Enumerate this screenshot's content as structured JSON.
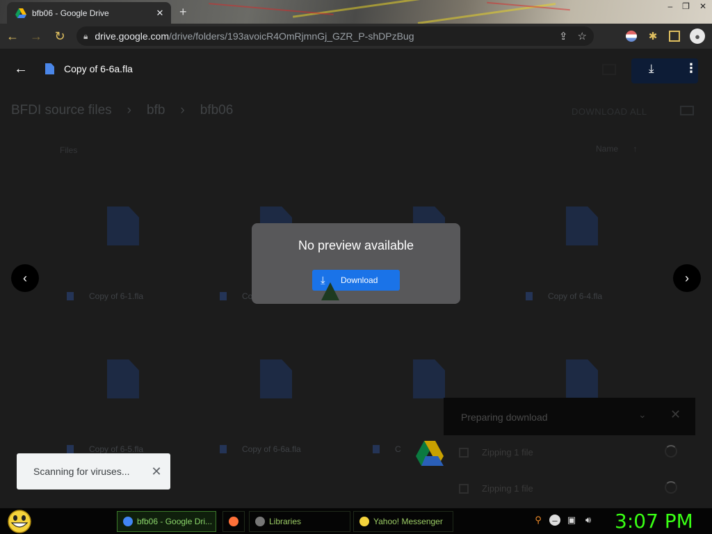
{
  "browser": {
    "tab_title": "bfb06 - Google Drive",
    "tab_close": "✕",
    "new_tab": "+",
    "url_host": "drive.google.com",
    "url_path": "/drive/folders/193avoicR4OmRjmnGj_GZR_P-shDPzBug",
    "window_controls": [
      "–",
      "❐",
      "✕"
    ],
    "nav": {
      "back": "←",
      "forward": "→",
      "reload": "↻"
    },
    "omnibox_icons": [
      "share-icon",
      "star-icon"
    ],
    "extension_icons": [
      "flag-icon",
      "puzzle-icon",
      "sidebar-icon",
      "profile-icon"
    ]
  },
  "viewer": {
    "back_label": "←",
    "file_title": "Copy of 6-6a.fla",
    "download_icon": "⤓",
    "menu_icon": "⋮",
    "prev": "‹",
    "next": "›",
    "no_preview": "No preview available",
    "download_button": "Download"
  },
  "drive": {
    "breadcrumb": [
      "BFDI source files",
      "›",
      "bfb",
      "›",
      "bfb06"
    ],
    "download_all": "DOWNLOAD ALL",
    "files_header": "Files",
    "name_header": "Name",
    "sort_arrow": "↑",
    "files_row1": [
      "Copy of 6-1.fla",
      "Co",
      "",
      "Copy of 6-4.fla"
    ],
    "files_row2": [
      "Copy of 6-5.fla",
      "Copy of 6-6a.fla",
      "C",
      ""
    ]
  },
  "downloads": {
    "title": "Preparing download",
    "chevron": "⌄",
    "close": "✕",
    "rows": [
      "Zipping 1 file",
      "Zipping 1 file"
    ]
  },
  "toast": {
    "text": "Scanning for viruses...",
    "close": "✕"
  },
  "taskbar": {
    "tasks": [
      {
        "label": "bfb06 - Google Dri...",
        "icon_color": "#4285f4",
        "active": true
      },
      {
        "label": "",
        "icon_color": "#ff7139",
        "active": false
      },
      {
        "label": "Libraries",
        "icon_color": "#777777",
        "active": false
      },
      {
        "label": "Yahoo! Messenger",
        "icon_color": "#f5d33c",
        "active": false
      }
    ],
    "tray_icons": [
      "search-icon",
      "minus-icon",
      "network-icon",
      "volume-icon"
    ],
    "clock": "3:07 PM"
  },
  "colors": {
    "accent": "#1a73e8",
    "clock": "#39ff14",
    "taskbar_text": "#8cd76b"
  }
}
